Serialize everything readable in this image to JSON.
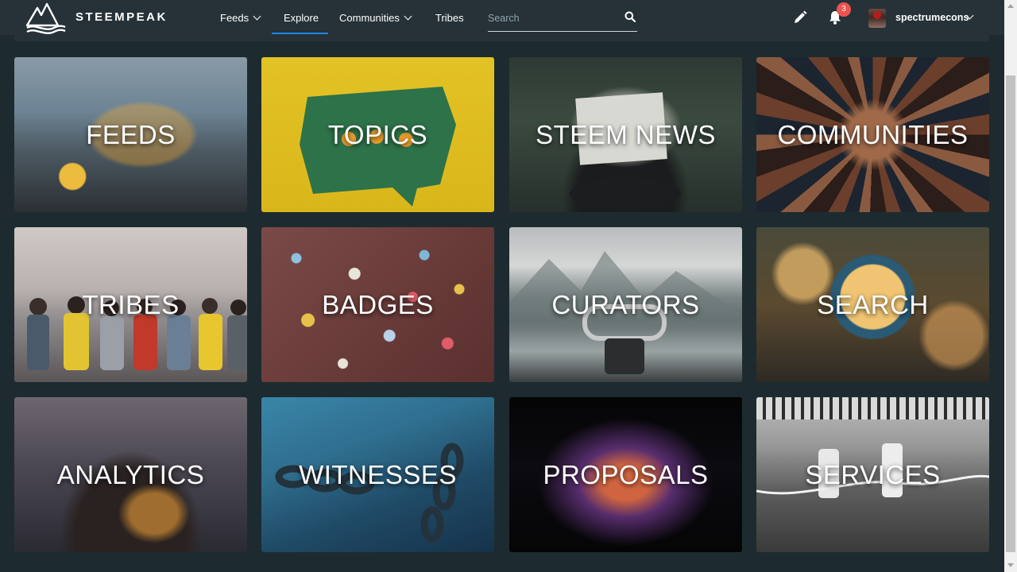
{
  "header": {
    "brand": "STEEMPEAK",
    "nav": [
      {
        "label": "Feeds",
        "dropdown": true
      },
      {
        "label": "Explore",
        "active": true
      },
      {
        "label": "Communities",
        "dropdown": true
      },
      {
        "label": "Tribes"
      }
    ],
    "search_placeholder": "Search",
    "notifications_count": "3",
    "username": "spectrumecons"
  },
  "tiles": [
    {
      "label": "FEEDS",
      "icon": "heart-lights-photo"
    },
    {
      "label": "TOPICS",
      "icon": "speech-bubble-photo"
    },
    {
      "label": "STEEM NEWS",
      "icon": "newspaper-reader-photo"
    },
    {
      "label": "COMMUNITIES",
      "icon": "hands-together-photo"
    },
    {
      "label": "TRIBES",
      "icon": "group-of-friends-photo"
    },
    {
      "label": "BADGES",
      "icon": "pins-on-fabric-photo"
    },
    {
      "label": "CURATORS",
      "icon": "binocular-viewer-photo"
    },
    {
      "label": "SEARCH",
      "icon": "magnifying-glass-photo"
    },
    {
      "label": "ANALYTICS",
      "icon": "hand-with-lights-photo"
    },
    {
      "label": "WITNESSES",
      "icon": "chain-photo"
    },
    {
      "label": "PROPOSALS",
      "icon": "laptop-glow-photo"
    },
    {
      "label": "SERVICES",
      "icon": "toy-figures-photo"
    }
  ],
  "colors": {
    "background": "#1d2b30",
    "header": "#263238",
    "accent": "#1e88e5",
    "badge": "#ef5350"
  }
}
